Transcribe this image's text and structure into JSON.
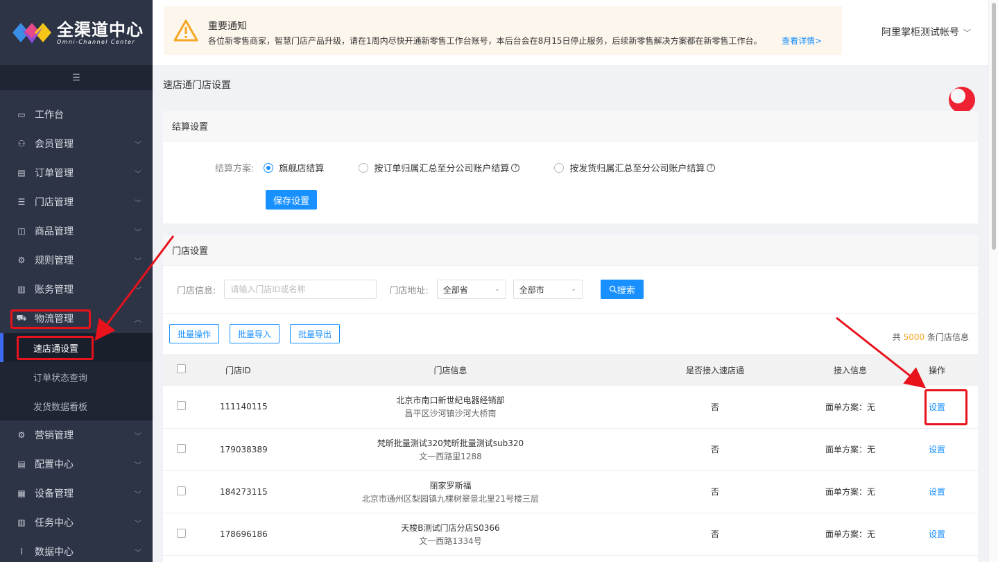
{
  "app": {
    "logo_main": "全渠道中心",
    "logo_sub": "Omni-Channel Center"
  },
  "sidebar": {
    "collapse_icon": "menu-collapse-icon",
    "items": [
      {
        "label": "工作台",
        "icon": "monitor-icon",
        "expandable": false
      },
      {
        "label": "会员管理",
        "icon": "users-icon",
        "expandable": true
      },
      {
        "label": "订单管理",
        "icon": "document-icon",
        "expandable": true
      },
      {
        "label": "门店管理",
        "icon": "list-icon",
        "expandable": true
      },
      {
        "label": "商品管理",
        "icon": "bag-icon",
        "expandable": true
      },
      {
        "label": "规则管理",
        "icon": "gear-icon",
        "expandable": true
      },
      {
        "label": "账务管理",
        "icon": "book-icon",
        "expandable": true
      },
      {
        "label": "物流管理",
        "icon": "truck-icon",
        "expandable": true,
        "expanded": true
      },
      {
        "label": "营销管理",
        "icon": "gear-icon",
        "expandable": true
      },
      {
        "label": "配置中心",
        "icon": "document-icon",
        "expandable": true
      },
      {
        "label": "设备管理",
        "icon": "grid-icon",
        "expandable": true
      },
      {
        "label": "任务中心",
        "icon": "book-icon",
        "expandable": true
      },
      {
        "label": "数据中心",
        "icon": "chart-icon",
        "expandable": true
      }
    ],
    "logistics_sub": [
      {
        "label": "速店通设置",
        "active": true
      },
      {
        "label": "订单状态查询",
        "active": false
      },
      {
        "label": "发货数据看板",
        "active": false
      }
    ]
  },
  "notice": {
    "icon": "warning-icon",
    "title": "重要通知",
    "body": "各位新零售商家，智慧门店产品升级，请在1周内尽快开通新零售工作台账号，本后台会在8月15日停止服务，后续新零售解决方案都在新零售工作台。",
    "link": "查看详情>"
  },
  "account": {
    "name": "阿里掌柜测试帐号"
  },
  "page": {
    "title": "速店通门店设置"
  },
  "settlement": {
    "header": "结算设置",
    "label": "结算方案:",
    "options": [
      {
        "label": "旗舰店结算",
        "checked": true,
        "help": false
      },
      {
        "label": "按订单归属汇总至分公司账户结算",
        "checked": false,
        "help": true
      },
      {
        "label": "按发货归属汇总至分公司账户结算",
        "checked": false,
        "help": true
      }
    ],
    "save_label": "保存设置"
  },
  "stores": {
    "header": "门店设置",
    "filter": {
      "info_label": "门店信息:",
      "info_placeholder": "请输入门店ID或名称",
      "address_label": "门店地址:",
      "province": "全部省",
      "city": "全部市",
      "search_label": "搜索"
    },
    "batch": {
      "operate": "批量操作",
      "import": "批量导入",
      "export": "批量导出"
    },
    "total": {
      "prefix": "共",
      "count": "5000",
      "suffix": "条门店信息"
    },
    "columns": [
      "门店ID",
      "门店信息",
      "是否接入速店通",
      "接入信息",
      "操作"
    ],
    "rows": [
      {
        "id": "111140115",
        "name": "北京市南口新世纪电器经销部",
        "addr": "昌平区沙河镇沙河大桥南",
        "connected": "否",
        "info": "面单方案：无",
        "action": "设置"
      },
      {
        "id": "179038389",
        "name": "梵昕批量测试320梵昕批量测试sub320",
        "addr": "文一西路里1288",
        "connected": "否",
        "info": "面单方案：无",
        "action": "设置"
      },
      {
        "id": "184273115",
        "name": "丽家罗斯福",
        "addr": "北京市通州区梨园镇九棵树翠景北里21号楼三层",
        "connected": "否",
        "info": "面单方案：无",
        "action": "设置"
      },
      {
        "id": "178696186",
        "name": "天梭B测试门店分店S0366",
        "addr": "文一西路1334号",
        "connected": "否",
        "info": "面单方案：无",
        "action": "设置"
      }
    ]
  },
  "colors": {
    "primary": "#1890ff",
    "sidebar_bg": "#2d3446",
    "annotation_red": "#e8121d",
    "notice_bg": "#fdf6ec",
    "count_color": "#f5a623"
  }
}
